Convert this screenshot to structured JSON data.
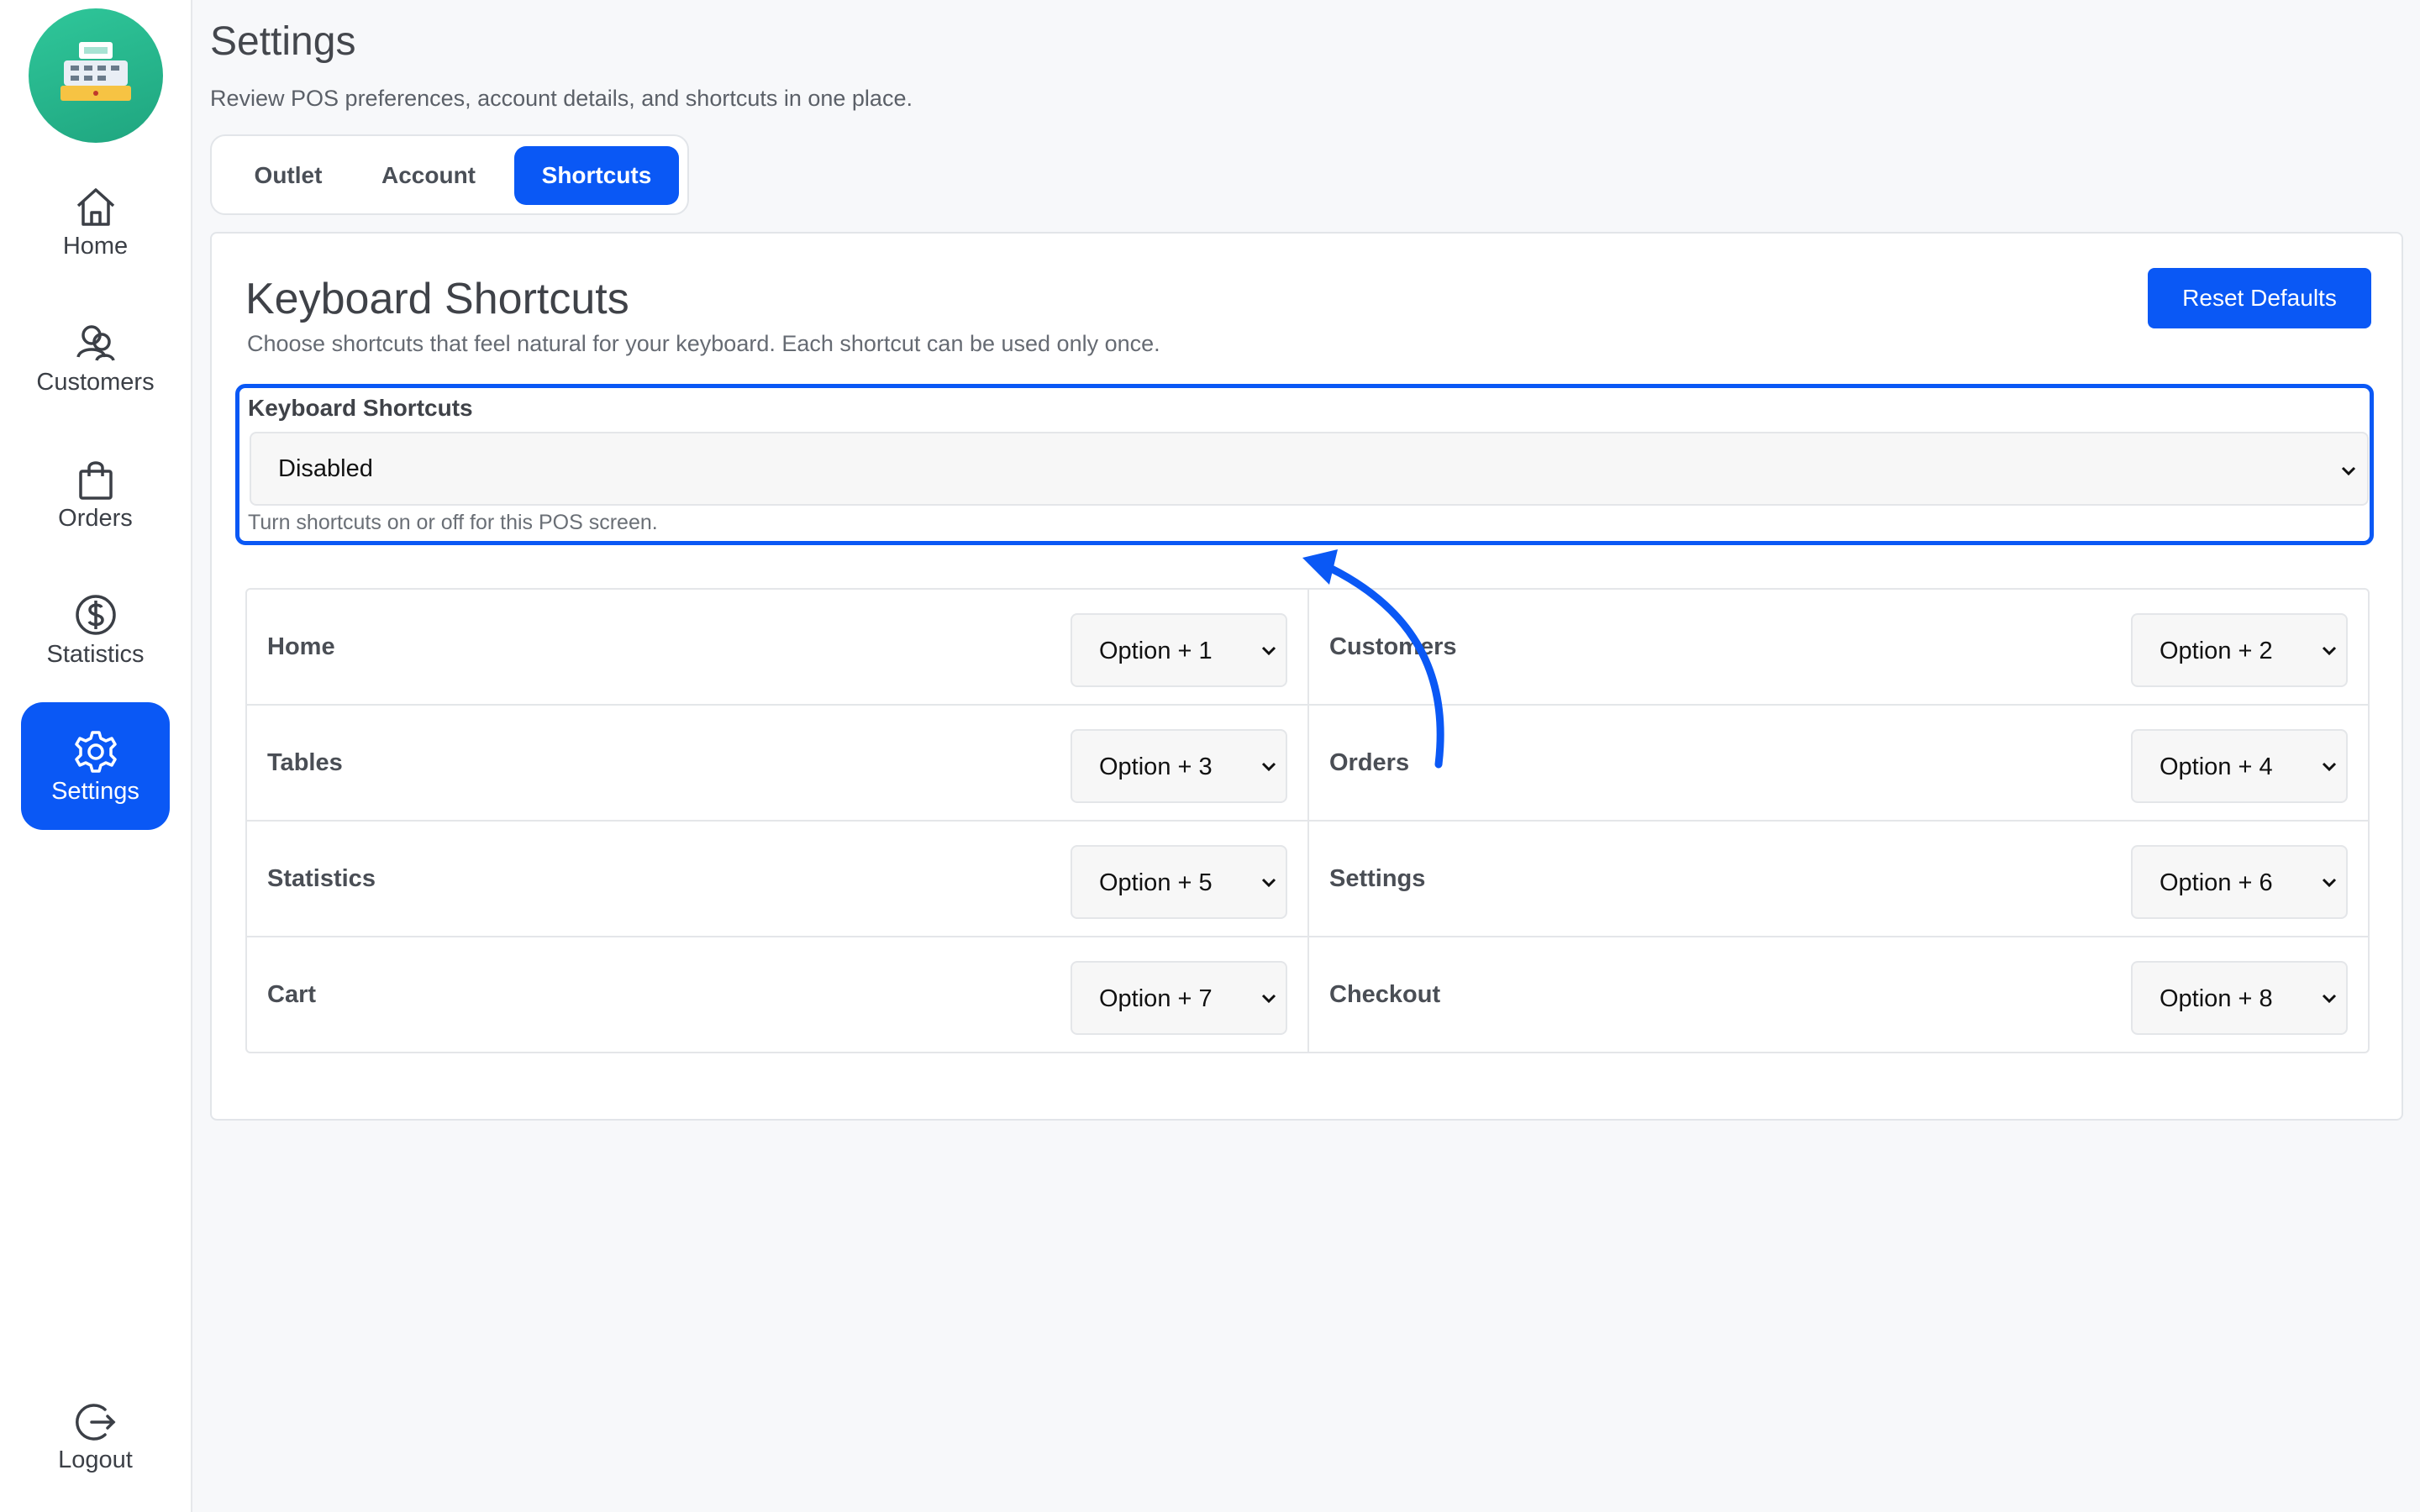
{
  "sidebar": {
    "items": [
      {
        "label": "Home",
        "icon": "home-icon"
      },
      {
        "label": "Customers",
        "icon": "customers-icon"
      },
      {
        "label": "Orders",
        "icon": "bag-icon"
      },
      {
        "label": "Statistics",
        "icon": "dollar-icon"
      },
      {
        "label": "Settings",
        "icon": "gear-icon",
        "active": true
      }
    ],
    "logout": {
      "label": "Logout",
      "icon": "logout-icon"
    }
  },
  "header": {
    "title": "Settings",
    "subtitle": "Review POS preferences, account details, and shortcuts in one place."
  },
  "tabs": [
    {
      "label": "Outlet"
    },
    {
      "label": "Account"
    },
    {
      "label": "Shortcuts",
      "active": true
    }
  ],
  "card": {
    "title": "Keyboard Shortcuts",
    "subtitle": "Choose shortcuts that feel natural for your keyboard. Each shortcut can be used only once.",
    "reset_label": "Reset Defaults",
    "toggle": {
      "label": "Keyboard Shortcuts",
      "value": "Disabled",
      "help": "Turn shortcuts on or off for this POS screen."
    },
    "shortcuts": [
      {
        "name": "Home",
        "value": "Option + 1"
      },
      {
        "name": "Customers",
        "value": "Option + 2"
      },
      {
        "name": "Tables",
        "value": "Option + 3"
      },
      {
        "name": "Orders",
        "value": "Option + 4"
      },
      {
        "name": "Statistics",
        "value": "Option + 5"
      },
      {
        "name": "Settings",
        "value": "Option + 6"
      },
      {
        "name": "Cart",
        "value": "Option + 7"
      },
      {
        "name": "Checkout",
        "value": "Option + 8"
      }
    ]
  },
  "colors": {
    "accent": "#0a58f5",
    "logo": "#2fc79a"
  }
}
